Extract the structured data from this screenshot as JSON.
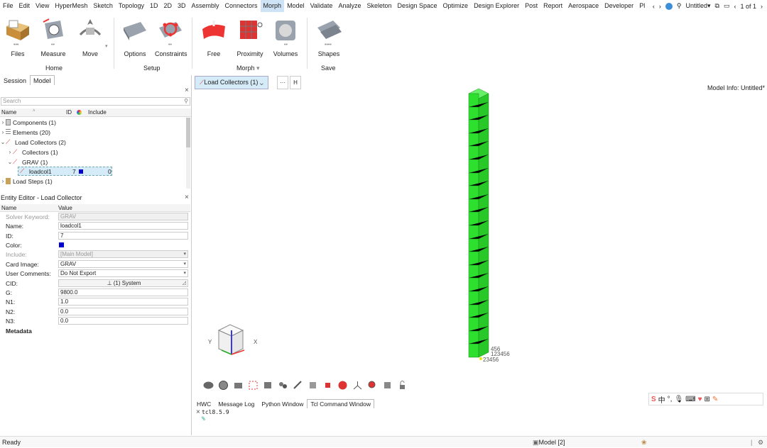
{
  "menu": [
    "File",
    "Edit",
    "View",
    "HyperMesh",
    "Sketch",
    "Topology",
    "1D",
    "2D",
    "3D",
    "Assembly",
    "Connectors",
    "Morph",
    "Model",
    "Validate",
    "Analyze",
    "Skeleton",
    "Design Space",
    "Optimize",
    "Design Explorer",
    "Post",
    "Report",
    "Aerospace",
    "Developer",
    "Pl"
  ],
  "menu_right": {
    "doc_title": "Untitled",
    "page": "1 of 1"
  },
  "ribbon": {
    "tools": [
      "Files",
      "Measure",
      "Move",
      "Options",
      "Constraints",
      "Free",
      "Proximity",
      "Volumes",
      "Shapes"
    ],
    "groups": [
      "Home",
      "Setup",
      "Morph",
      "Save"
    ]
  },
  "panel_tabs": [
    "Session",
    "Model"
  ],
  "search_placeholder": "Search",
  "tree_headers": {
    "name": "Name",
    "id": "ID",
    "include": "Include"
  },
  "tree": [
    {
      "label": "Components (1)"
    },
    {
      "label": "Elements (20)"
    },
    {
      "label": "Load Collectors (2)"
    },
    {
      "label": "Collectors (1)"
    },
    {
      "label": "GRAV (1)"
    },
    {
      "label": "loadcol1",
      "id": "7",
      "include": "0"
    },
    {
      "label": "Load Steps (1)"
    }
  ],
  "editor": {
    "title": "Entity Editor - Load Collector",
    "headers": {
      "name": "Name",
      "value": "Value"
    },
    "rows": [
      {
        "k": "Solver Keyword:",
        "v": "GRAV"
      },
      {
        "k": "Name:",
        "v": "loadcol1"
      },
      {
        "k": "ID:",
        "v": "7"
      },
      {
        "k": "Color:",
        "v": ""
      },
      {
        "k": "Include:",
        "v": "[Main Model]"
      },
      {
        "k": "Card Image:",
        "v": "GRAV"
      },
      {
        "k": "User Comments:",
        "v": "Do Not Export"
      },
      {
        "k": "CID:",
        "v": "(1) System"
      },
      {
        "k": "G:",
        "v": "9800.0"
      },
      {
        "k": "N1:",
        "v": "1.0"
      },
      {
        "k": "N2:",
        "v": "0.0"
      },
      {
        "k": "N3:",
        "v": "0.0"
      }
    ],
    "metadata": "Metadata"
  },
  "view": {
    "tab": "Load Collectors (1)",
    "btn_more": "···",
    "btn_h": "H",
    "model_info": "Model Info: Untitled*",
    "node_labels": [
      "456",
      "123456",
      "23456"
    ],
    "axis_y": "Y",
    "axis_x": "X"
  },
  "bottom_tabs": [
    "HWC",
    "Message Log",
    "Python Window",
    "Tcl Command Window"
  ],
  "console": [
    "tcl8.5.9",
    "%"
  ],
  "status": {
    "ready": "Ready",
    "model": "Model [2]"
  },
  "ime_char": "中",
  "colors": {
    "mesh": "#2ee02e",
    "collector": "#0000cc",
    "accent": "#d6ebf8"
  }
}
